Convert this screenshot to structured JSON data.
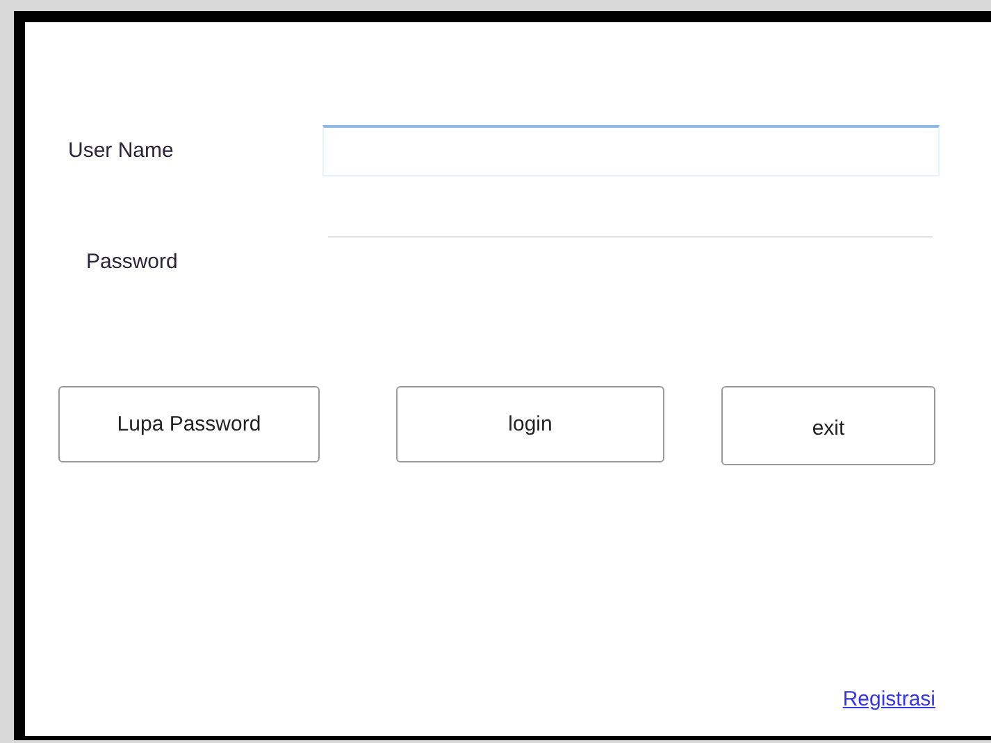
{
  "fields": [
    {
      "label": "User Name",
      "kind": "text",
      "focused": true
    },
    {
      "label": "Password",
      "kind": "password",
      "focused": false
    }
  ],
  "buttons": [
    "Lupa Password",
    "login",
    "exit"
  ],
  "link": "Registrasi"
}
